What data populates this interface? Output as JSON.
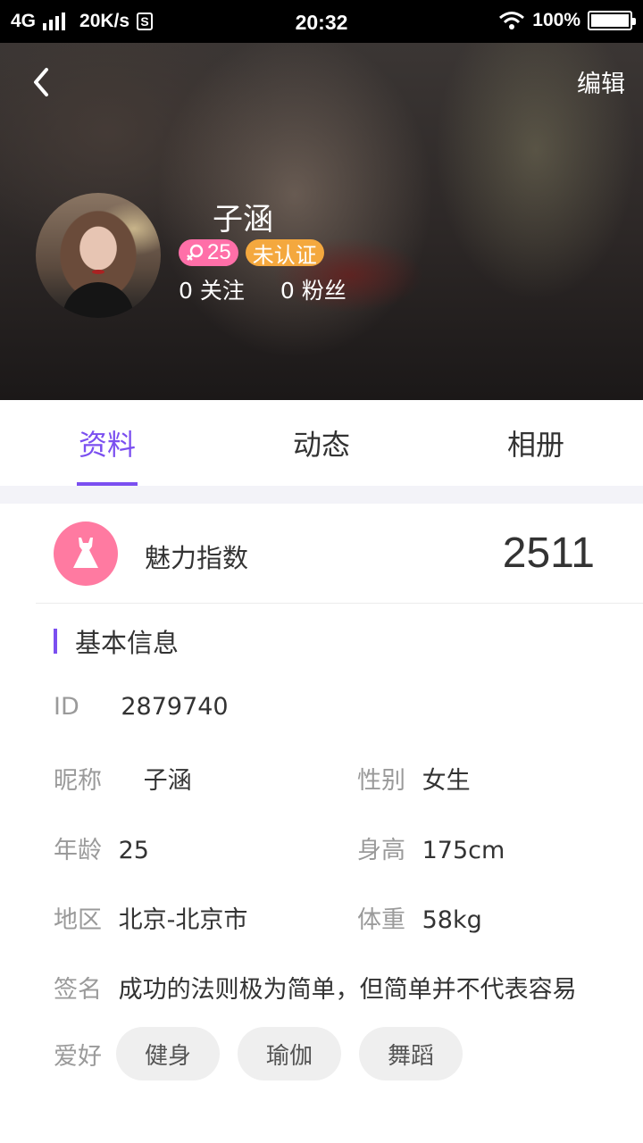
{
  "status_bar": {
    "network": "4G",
    "speed": "20K/s",
    "app_icon_letter": "S",
    "time": "20:32",
    "battery": "100%",
    "battery_level": 1.0
  },
  "header": {
    "edit_label": "编辑",
    "nickname": "子涵",
    "age": "25",
    "certification": "未认证",
    "follow_text": "0 关注",
    "fans_text": "0 粉丝"
  },
  "tabs": [
    {
      "label": "资料",
      "active": true
    },
    {
      "label": "动态",
      "active": false
    },
    {
      "label": "相册",
      "active": false
    }
  ],
  "charm": {
    "label": "魅力指数",
    "value": "2511"
  },
  "info": {
    "section_title": "基本信息",
    "id_label": "ID",
    "id_value": "2879740",
    "nickname_label": "昵称",
    "nickname_value": "子涵",
    "gender_label": "性别",
    "gender_value": "女生",
    "age_label": "年龄",
    "age_value": "25",
    "height_label": "身高",
    "height_value": "175cm",
    "region_label": "地区",
    "region_value": "北京-北京市",
    "weight_label": "体重",
    "weight_value": "58kg",
    "signature_label": "签名",
    "signature_value": "成功的法则极为简单，但简单并不代表容易",
    "hobby_label": "爱好",
    "hobbies": [
      "健身",
      "瑜伽",
      "舞蹈"
    ]
  },
  "colors": {
    "accent": "#7b4ff0",
    "age_badge": "#ff6fa8",
    "cert_badge": "#f4a83e",
    "charm_icon": "#ff7aa1"
  }
}
